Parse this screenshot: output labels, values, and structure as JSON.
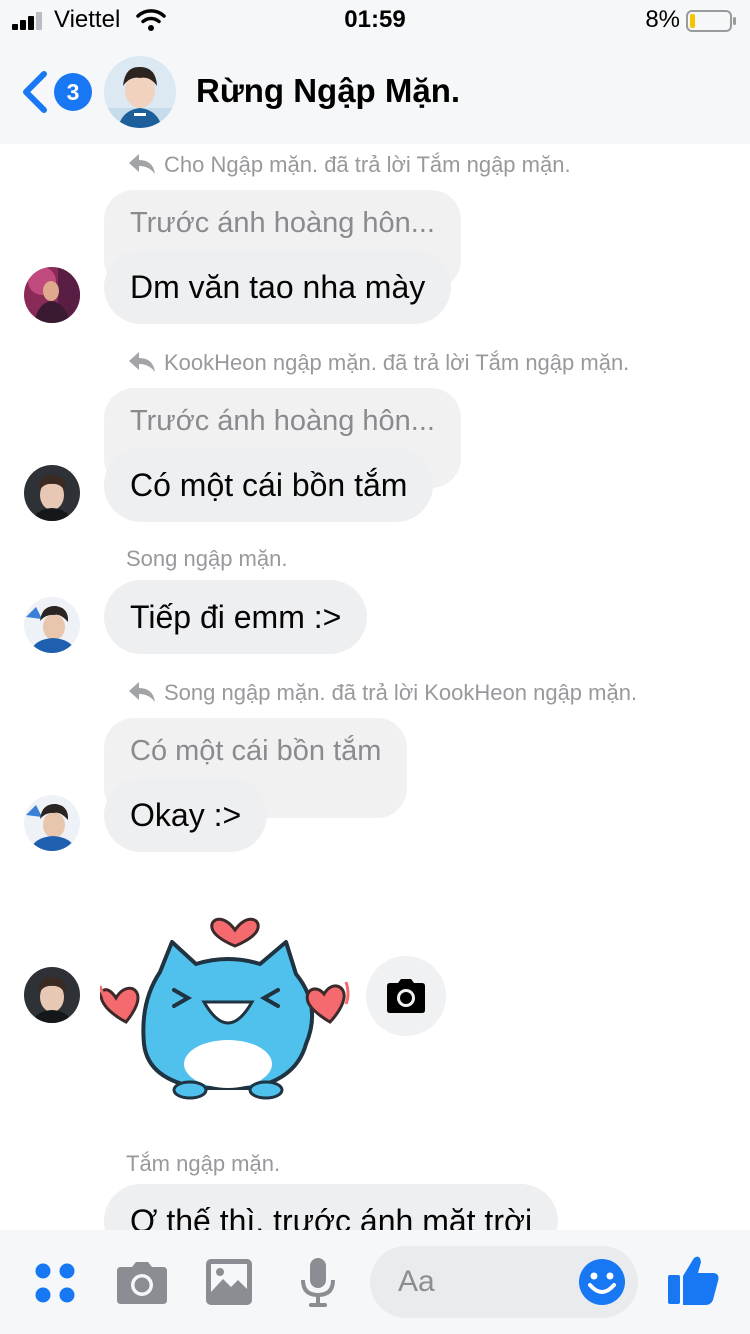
{
  "status_bar": {
    "carrier": "Viettel",
    "time": "01:59",
    "battery": "8%"
  },
  "header": {
    "back_badge": "3",
    "title": "Rừng Ngập Mặn."
  },
  "messages": [
    {
      "reply_header": "Cho Ngập mặn. đã trả lời Tắm ngập mặn.",
      "quoted": "Trước ánh hoàng hôn...",
      "text": "Dm văn tao nha mày"
    },
    {
      "reply_header": "KookHeon ngập mặn. đã trả lời Tắm ngập mặn.",
      "quoted": "Trước ánh hoàng hôn...",
      "text": "Có một cái bồn tắm"
    },
    {
      "sender": "Song ngập mặn.",
      "text": "Tiếp đi emm :>"
    },
    {
      "reply_header": "Song ngập mặn. đã trả lời KookHeon ngập mặn.",
      "quoted": "Có một cái bồn tắm",
      "text": "Okay :>"
    },
    {
      "sender": "Tắm ngập mặn.",
      "text": "Ơ thế thì, trước ánh mặt trời"
    }
  ],
  "composer": {
    "placeholder": "Aa"
  },
  "colors": {
    "accent": "#1877f2",
    "bubble": "#eeeff1",
    "meta_text": "#98999c"
  }
}
